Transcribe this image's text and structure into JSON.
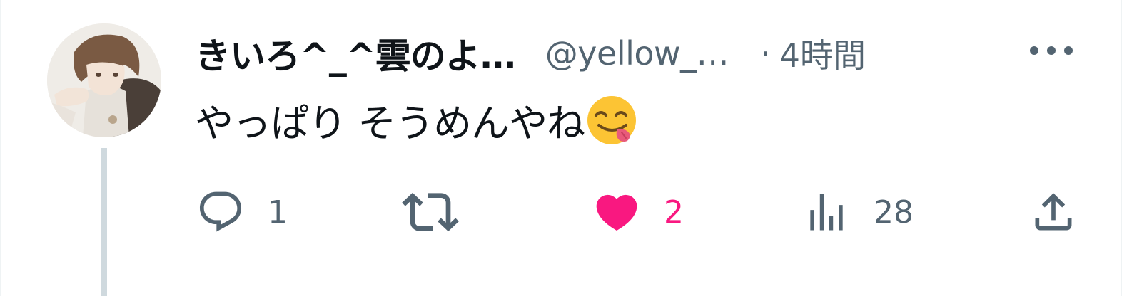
{
  "tweet": {
    "display_name": "きいろ^_^雲のよ…",
    "handle": "@yellow_…",
    "separator": "·",
    "time": "4時間",
    "text": "やっぱり そうめんやね",
    "emoji": "face-savoring-food-emoji"
  },
  "actions": {
    "reply": {
      "count": "1",
      "icon": "reply-icon"
    },
    "retweet": {
      "count": "",
      "icon": "retweet-icon"
    },
    "like": {
      "count": "2",
      "icon": "heart-icon",
      "liked": true
    },
    "views": {
      "count": "28",
      "icon": "views-icon"
    },
    "share": {
      "icon": "share-icon"
    }
  },
  "colors": {
    "text_primary": "#0f1419",
    "text_secondary": "#536471",
    "like_pink": "#f91880",
    "thread_line": "#cfd9de"
  }
}
